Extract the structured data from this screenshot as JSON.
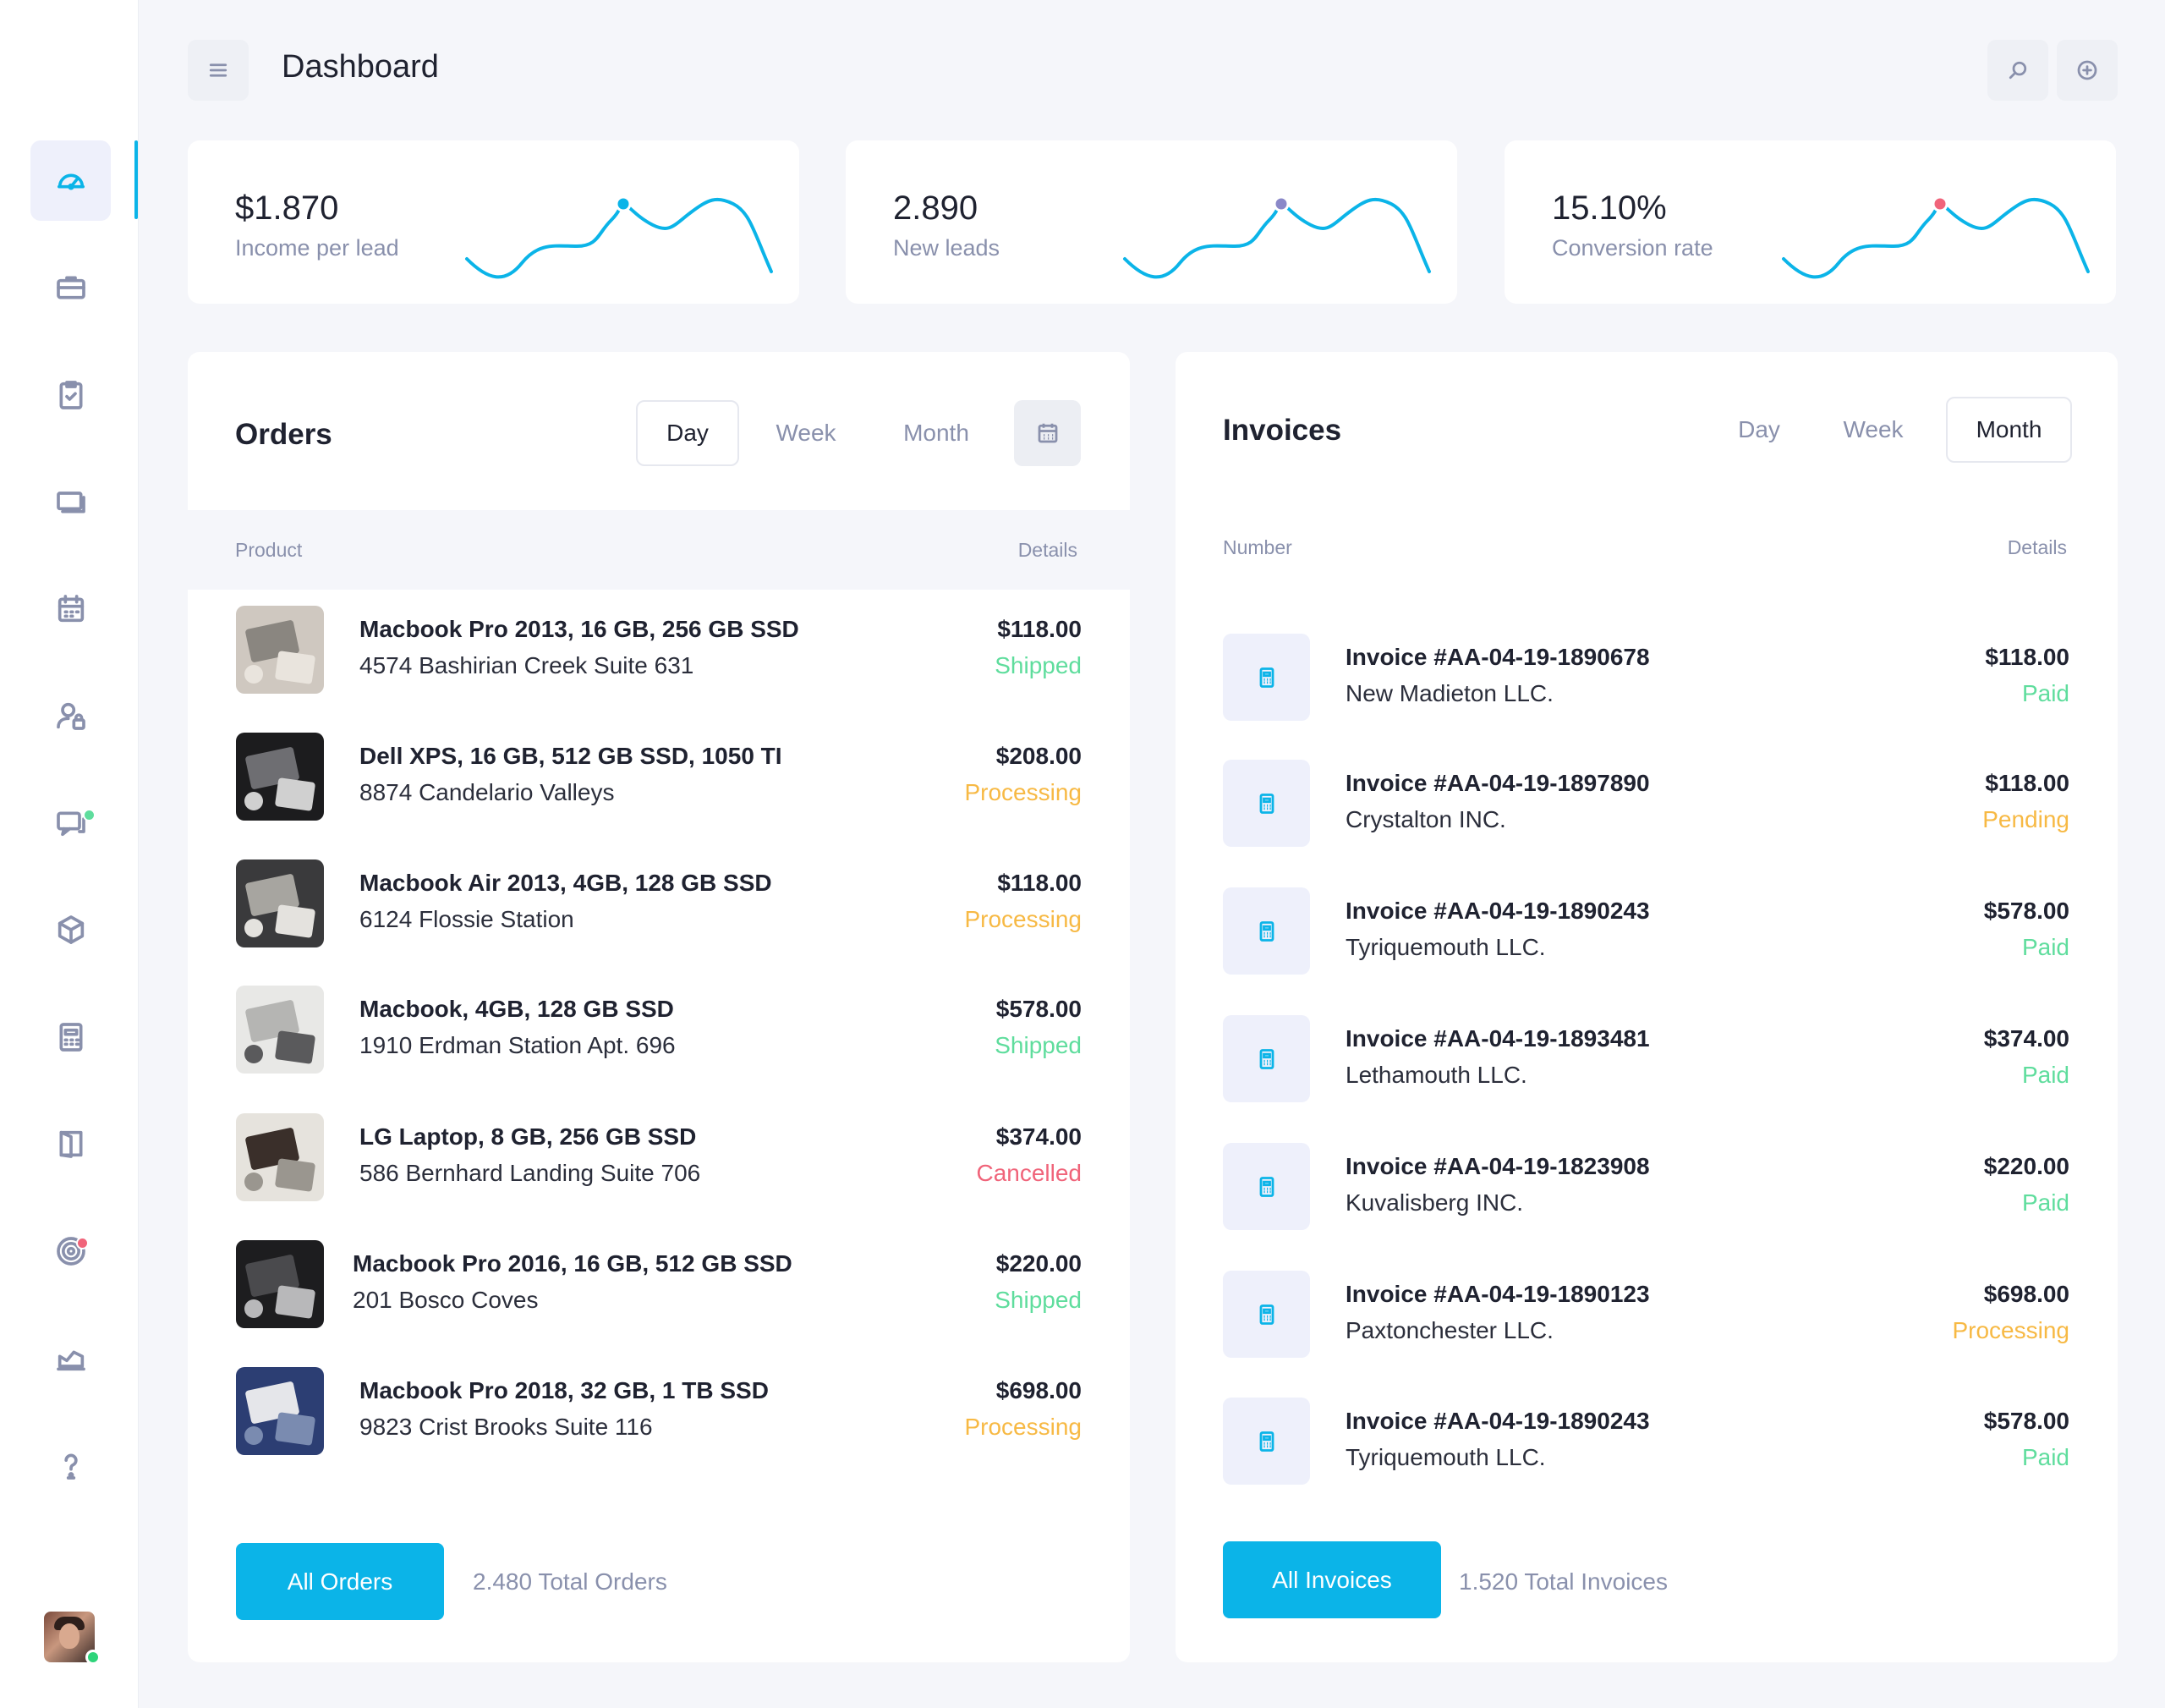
{
  "header": {
    "title": "Dashboard"
  },
  "sidebar": {
    "items": [
      {
        "icon": "speedometer-icon"
      },
      {
        "icon": "briefcase-icon"
      },
      {
        "icon": "clipboard-check-icon"
      },
      {
        "icon": "slides-icon"
      },
      {
        "icon": "calendar-icon"
      },
      {
        "icon": "user-lock-icon"
      },
      {
        "icon": "chat-icon"
      },
      {
        "icon": "box-icon"
      },
      {
        "icon": "calculator-icon"
      },
      {
        "icon": "book-icon"
      },
      {
        "icon": "target-icon"
      },
      {
        "icon": "area-chart-icon"
      },
      {
        "icon": "help-icon"
      }
    ]
  },
  "stats": [
    {
      "value": "$1.870",
      "label": "Income per lead",
      "dot_color": "#0bb4e8"
    },
    {
      "value": "2.890",
      "label": "New leads",
      "dot_color": "#8a88c8"
    },
    {
      "value": "15.10%",
      "label": "Conversion rate",
      "dot_color": "#f0647a"
    }
  ],
  "orders": {
    "title": "Orders",
    "tabs": {
      "day": "Day",
      "week": "Week",
      "month": "Month"
    },
    "active_tab": "Day",
    "columns": {
      "product": "Product",
      "details": "Details"
    },
    "rows": [
      {
        "title": "Macbook Pro 2013, 16 GB, 256 GB SSD",
        "address": "4574 Bashirian Creek Suite 631",
        "price": "$118.00",
        "status": "Shipped"
      },
      {
        "title": "Dell XPS, 16 GB, 512 GB SSD, 1050 TI",
        "address": "8874 Candelario Valleys",
        "price": "$208.00",
        "status": "Processing"
      },
      {
        "title": "Macbook Air 2013, 4GB, 128 GB SSD",
        "address": "6124 Flossie Station",
        "price": "$118.00",
        "status": "Processing"
      },
      {
        "title": "Macbook, 4GB, 128 GB SSD",
        "address": "1910 Erdman Station Apt. 696",
        "price": "$578.00",
        "status": "Shipped"
      },
      {
        "title": "LG Laptop, 8 GB, 256 GB SSD",
        "address": "586 Bernhard Landing Suite 706",
        "price": "$374.00",
        "status": "Cancelled"
      },
      {
        "title": "Macbook Pro 2016, 16 GB, 512 GB SSD",
        "address": "201 Bosco Coves",
        "price": "$220.00",
        "status": "Shipped"
      },
      {
        "title": "Macbook Pro 2018, 32 GB, 1 TB SSD",
        "address": "9823 Crist Brooks Suite 116",
        "price": "$698.00",
        "status": "Processing"
      }
    ],
    "button": "All Orders",
    "total": "2.480 Total Orders"
  },
  "invoices": {
    "title": "Invoices",
    "tabs": {
      "day": "Day",
      "week": "Week",
      "month": "Month"
    },
    "active_tab": "Month",
    "columns": {
      "number": "Number",
      "details": "Details"
    },
    "rows": [
      {
        "number": "Invoice #AA-04-19-1890678",
        "company": "New Madieton LLC.",
        "price": "$118.00",
        "status": "Paid"
      },
      {
        "number": "Invoice #AA-04-19-1897890",
        "company": "Crystalton INC.",
        "price": "$118.00",
        "status": "Pending"
      },
      {
        "number": "Invoice #AA-04-19-1890243",
        "company": "Tyriquemouth LLC.",
        "price": "$578.00",
        "status": "Paid"
      },
      {
        "number": "Invoice #AA-04-19-1893481",
        "company": "Lethamouth LLC.",
        "price": "$374.00",
        "status": "Paid"
      },
      {
        "number": "Invoice #AA-04-19-1823908",
        "company": "Kuvalisberg INC.",
        "price": "$220.00",
        "status": "Paid"
      },
      {
        "number": "Invoice #AA-04-19-1890123",
        "company": "Paxtonchester LLC.",
        "price": "$698.00",
        "status": "Processing"
      },
      {
        "number": "Invoice #AA-04-19-1890243",
        "company": "Tyriquemouth LLC.",
        "price": "$578.00",
        "status": "Paid"
      }
    ],
    "button": "All Invoices",
    "total": "1.520 Total Invoices"
  },
  "colors": {
    "accent": "#0bb4e8",
    "success": "#5fdd9d",
    "warning": "#f7b944",
    "danger": "#f0647a"
  }
}
